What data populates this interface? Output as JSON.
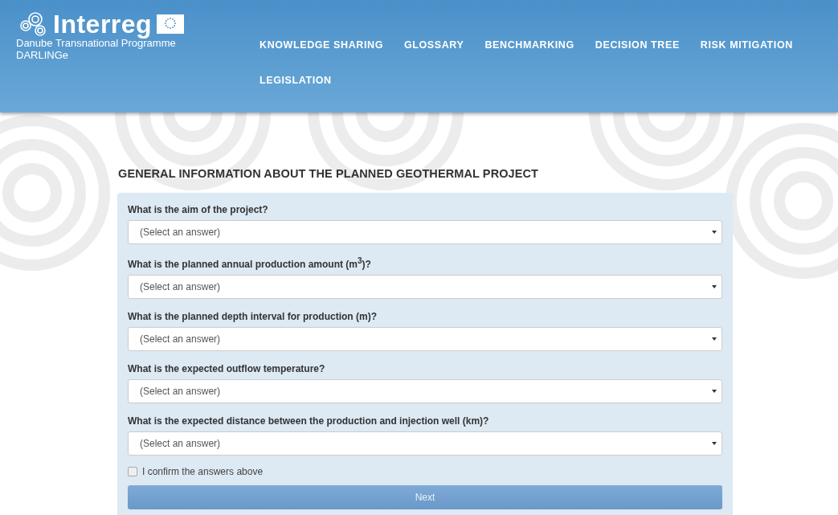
{
  "brand": {
    "name": "Interreg",
    "programme": "Danube Transnational Programme",
    "project": "DARLINGe"
  },
  "nav": [
    {
      "label": "KNOWLEDGE SHARING"
    },
    {
      "label": "GLOSSARY"
    },
    {
      "label": "BENCHMARKING"
    },
    {
      "label": "DECISION TREE"
    },
    {
      "label": "RISK MITIGATION"
    },
    {
      "label": "LEGISLATION"
    }
  ],
  "title": "GENERAL INFORMATION ABOUT THE PLANNED GEOTHERMAL PROJECT",
  "questions": [
    {
      "label": "What is the aim of the project?",
      "value": "(Select an answer)"
    },
    {
      "label": "What is the planned annual production amount (m$^{3}$)?",
      "value": "(Select an answer)"
    },
    {
      "label": "What is the planned depth interval for production (m)?",
      "value": "(Select an answer)"
    },
    {
      "label": "What is the expected outflow temperature?",
      "value": "(Select an answer)"
    },
    {
      "label": "What is the expected distance between the production and injection well (km)?",
      "value": "(Select an answer)"
    }
  ],
  "confirm": {
    "label": "I confirm the answers above",
    "checked": false
  },
  "next_button": "Next"
}
